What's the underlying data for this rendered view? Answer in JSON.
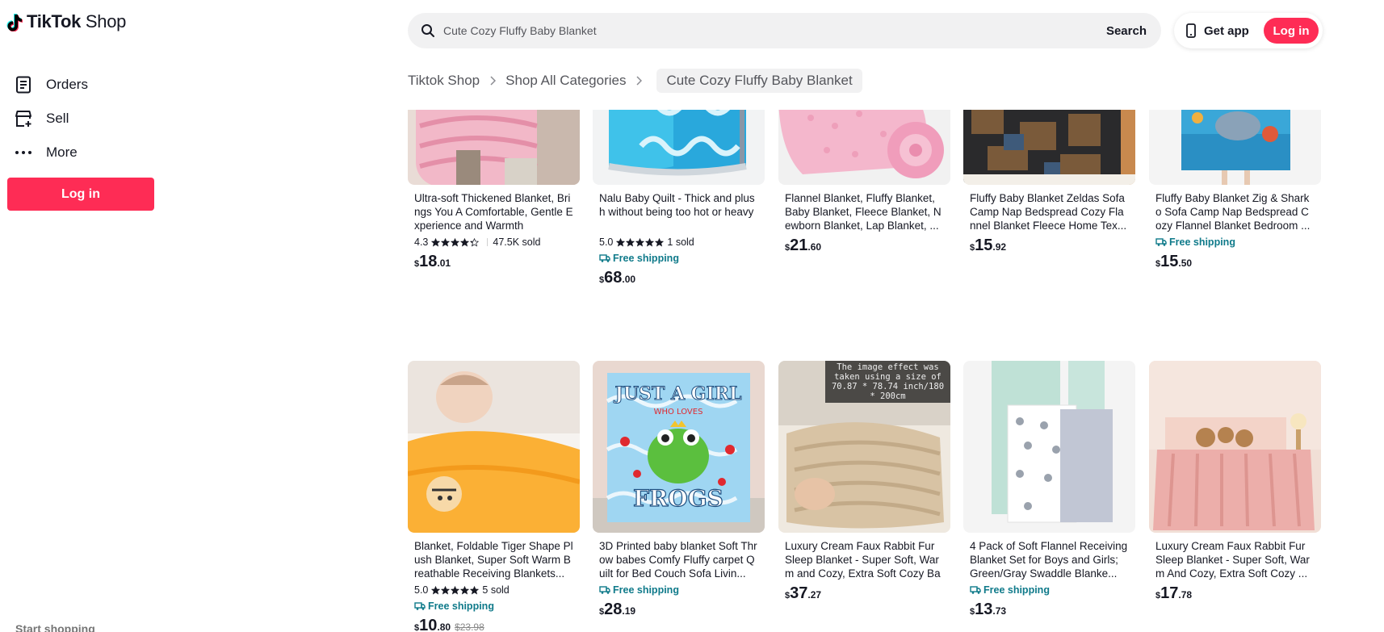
{
  "logo": {
    "brand": "TikTok",
    "suffix": "Shop"
  },
  "sidebar": {
    "items": [
      {
        "label": "Orders",
        "icon": "orders-icon"
      },
      {
        "label": "Sell",
        "icon": "sell-store-icon"
      },
      {
        "label": "More",
        "icon": "more-dots-icon"
      }
    ],
    "login_label": "Log in",
    "start_shopping": "Start shopping"
  },
  "header": {
    "search_value": "Cute Cozy Fluffy Baby Blanket",
    "search_button": "Search",
    "get_app": "Get app",
    "login_label": "Log in"
  },
  "breadcrumb": {
    "items": [
      "Tiktok Shop",
      "Shop All Categories"
    ],
    "current": "Cute Cozy Fluffy Baby Blanket"
  },
  "colors": {
    "accent": "#fe2c55",
    "shipping": "#0f7a8a",
    "surface": "#f1f1f2"
  },
  "products": [
    {
      "title": "Ultra-soft Thickened Blanket, Brings You A Comfortable, Gentle Experience and Warmth",
      "rating": "4.3",
      "stars": 4.3,
      "sold": "47.5K sold",
      "free_shipping": false,
      "price_int": "18",
      "price_dec": ".01"
    },
    {
      "title": "Nalu Baby Quilt - Thick and plush without being too hot or heavy",
      "rating": "5.0",
      "stars": 5,
      "sold": "1 sold",
      "free_shipping": true,
      "shipping_label": "Free shipping",
      "price_int": "68",
      "price_dec": ".00"
    },
    {
      "title": "Flannel Blanket, Fluffy Blanket, Baby Blanket, Fleece Blanket, Newborn Blanket, Lap Blanket, ...",
      "free_shipping": false,
      "price_int": "21",
      "price_dec": ".60"
    },
    {
      "title": "Fluffy Baby Blanket Zeldas Sofa Camp Nap Bedspread Cozy Flannel Blanket Fleece Home Tex...",
      "free_shipping": false,
      "price_int": "15",
      "price_dec": ".92"
    },
    {
      "title": "Fluffy Baby Blanket Zig & Shark o Sofa Camp Nap Bedspread Cozy Flannel Blanket Bedroom ...",
      "free_shipping": true,
      "shipping_label": "Free shipping",
      "price_int": "15",
      "price_dec": ".50"
    },
    {
      "title": "Blanket, Foldable Tiger Shape Plush Blanket, Super Soft Warm Breathable Receiving Blankets...",
      "rating": "5.0",
      "stars": 5,
      "sold": "5 sold",
      "free_shipping": true,
      "shipping_label": "Free shipping",
      "price_int": "10",
      "price_dec": ".80",
      "price_old": "$23.98"
    },
    {
      "title": "3D Printed baby blanket Soft Throw babes Comfy Fluffy carpet Quilt for Bed Couch Sofa Livin...",
      "free_shipping": true,
      "shipping_label": "Free shipping",
      "price_int": "28",
      "price_dec": ".19",
      "image_text_1": "JUST A GIRL",
      "image_text_2": "WHO LOVES",
      "image_text_3": "FROGS"
    },
    {
      "title": "Luxury Cream Faux Rabbit Fur Sleep Blanket - Super Soft, Warm and Cozy, Extra Soft Cozy Bab...",
      "free_shipping": false,
      "price_int": "37",
      "price_dec": ".27",
      "image_note": "The image effect was taken using a size of 70.87 * 78.74 inch/180 * 200cm"
    },
    {
      "title": "4 Pack of Soft Flannel Receiving Blanket Set for Boys and Girls; Green/Gray Swaddle Blanke...",
      "free_shipping": true,
      "shipping_label": "Free shipping",
      "price_int": "13",
      "price_dec": ".73"
    },
    {
      "title": "Luxury Cream Faux Rabbit Fur Sleep Blanket - Super Soft, Warm And Cozy, Extra Soft Cozy ...",
      "free_shipping": false,
      "price_int": "17",
      "price_dec": ".78"
    }
  ]
}
